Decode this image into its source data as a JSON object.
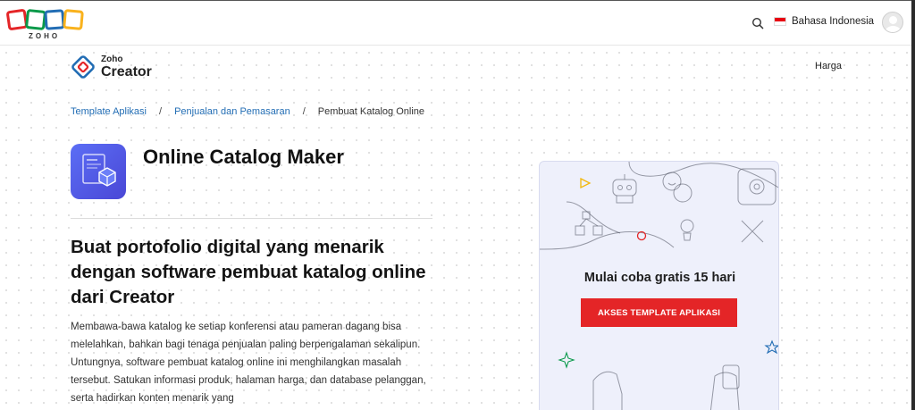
{
  "topbar": {
    "logo_text": "ZOHO",
    "search_icon": "search-icon",
    "language": "Bahasa Indonesia",
    "flag_colors": [
      "#e70011",
      "#ffffff"
    ]
  },
  "product": {
    "brand_small": "Zoho",
    "brand_big": "Creator",
    "nav_pricing": "Harga"
  },
  "breadcrumb": {
    "items": [
      "Template Aplikasi",
      "Penjualan dan Pemasaran"
    ],
    "separator": "/",
    "current": "Pembuat Katalog Online"
  },
  "app": {
    "title": "Online Catalog Maker",
    "icon": "catalog-document-icon"
  },
  "content": {
    "headline": "Buat portofolio digital yang menarik dengan software pembuat katalog online dari Creator",
    "description": "Membawa-bawa katalog ke setiap konferensi atau pameran dagang bisa melelahkan, bahkan bagi tenaga penjualan paling berpengalaman sekalipun. Untungnya, software pembuat katalog online ini menghilangkan masalah tersebut. Satukan informasi produk, halaman harga, dan database pelanggan, serta hadirkan konten menarik yang"
  },
  "promo": {
    "heading": "Mulai coba gratis 15 hari",
    "cta": "AKSES TEMPLATE APLIKASI"
  },
  "colors": {
    "brand_red": "#e42527",
    "link_blue": "#226db4",
    "app_icon": "#5063ee",
    "promo_bg": "#eef0fb"
  }
}
